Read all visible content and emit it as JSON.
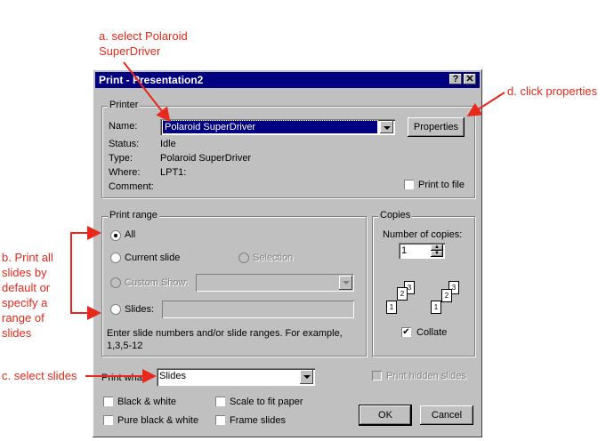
{
  "annotations": {
    "a": "a. select Polaroid SuperDriver",
    "a_line1": "a. select Polaroid",
    "a_line2": "SuperDriver",
    "d": "d. click properties",
    "b_lines": [
      "b. Print all",
      "slides by",
      "default or",
      "specify a",
      "range of",
      "slides"
    ],
    "c": "c. select slides",
    "color": "#e8281a"
  },
  "dialog": {
    "title": "Print - Presentation2",
    "help_btn": "?",
    "close_btn": "✕",
    "printer": {
      "group": "Printer",
      "name_label": "Name:",
      "name_value": "Polaroid SuperDriver",
      "properties_btn": "Properties",
      "status_label": "Status:",
      "status_value": "Idle",
      "type_label": "Type:",
      "type_value": "Polaroid SuperDriver",
      "where_label": "Where:",
      "where_value": "LPT1:",
      "comment_label": "Comment:",
      "print_to_file": "Print to file"
    },
    "range": {
      "group": "Print range",
      "all": "All",
      "current": "Current slide",
      "selection": "Selection",
      "custom": "Custom Show:",
      "slides": "Slides:",
      "hint": "Enter slide numbers and/or slide ranges. For example, 1,3,5-12"
    },
    "copies": {
      "group": "Copies",
      "number_label": "Number of copies:",
      "number_value": "1",
      "collate": "Collate"
    },
    "print_what_label": "Print what:",
    "print_what_value": "Slides",
    "print_hidden": "Print hidden slides",
    "bw": "Black & white",
    "pure_bw": "Pure black & white",
    "scale": "Scale to fit paper",
    "frame": "Frame slides",
    "ok": "OK",
    "cancel": "Cancel"
  }
}
